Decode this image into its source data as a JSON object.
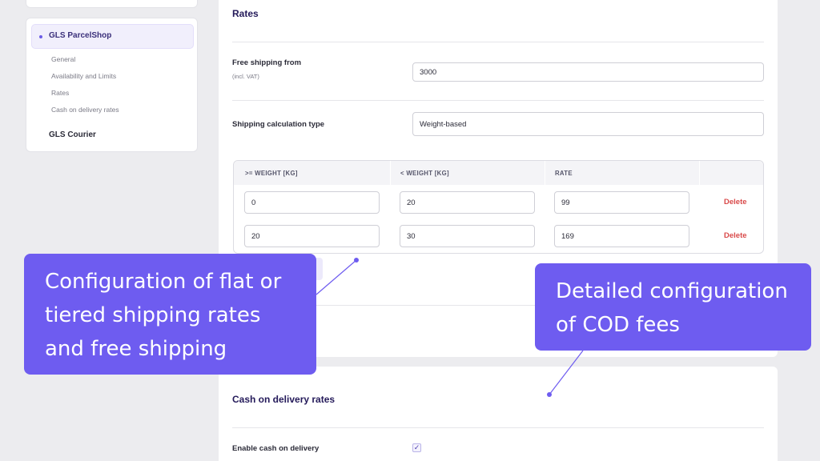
{
  "sidebar": {
    "active_item": "GLS ParcelShop",
    "sub_items": [
      "General",
      "Availability and Limits",
      "Rates",
      "Cash on delivery rates"
    ],
    "other_item": "GLS Courier"
  },
  "rates": {
    "title": "Rates",
    "free_shipping_label": "Free shipping from",
    "free_shipping_hint": "(incl. VAT)",
    "free_shipping_value": "3000",
    "calc_type_label": "Shipping calculation type",
    "calc_type_value": "Weight-based",
    "table": {
      "headers": [
        ">= WEIGHT [KG]",
        "< WEIGHT [KG]",
        "RATE"
      ],
      "rows": [
        {
          "min": "0",
          "max": "20",
          "rate": "99",
          "action": "Delete"
        },
        {
          "min": "20",
          "max": "30",
          "rate": "169",
          "action": "Delete"
        }
      ]
    }
  },
  "cod": {
    "title": "Cash on delivery rates",
    "enable_label": "Enable cash on delivery",
    "enabled": true
  },
  "callouts": {
    "left_text": "Configuration of flat or tiered shipping rates and free shipping",
    "right_text": "Detailed configuration of COD fees"
  },
  "colors": {
    "accent": "#6e5cf0",
    "delete": "#d94a4a",
    "background": "#ececef"
  }
}
